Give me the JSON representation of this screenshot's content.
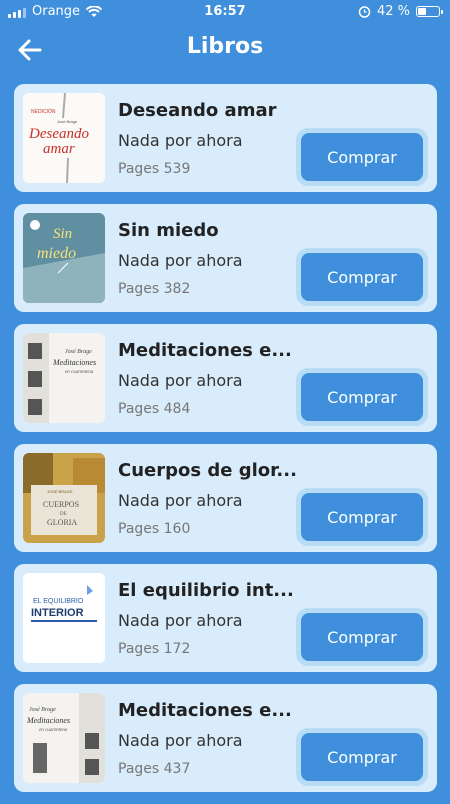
{
  "status_bar": {
    "carrier": "Orange",
    "time": "16:57",
    "battery": "42 %",
    "battery_level": 0.42
  },
  "header": {
    "title": "Libros"
  },
  "books": [
    {
      "title": "Deseando amar",
      "status": "Nada por ahora",
      "pages": "Pages 539",
      "button": "Comprar",
      "cover": "deseando-amar-cover"
    },
    {
      "title": "Sin miedo",
      "status": "Nada por ahora",
      "pages": "Pages 382",
      "button": "Comprar",
      "cover": "sin-miedo-cover"
    },
    {
      "title": "Meditaciones e...",
      "status": "Nada por ahora",
      "pages": "Pages 484",
      "button": "Comprar",
      "cover": "meditaciones-cover"
    },
    {
      "title": "Cuerpos de glor...",
      "status": "Nada por ahora",
      "pages": "Pages 160",
      "button": "Comprar",
      "cover": "cuerpos-de-gloria-cover"
    },
    {
      "title": "El equilibrio int...",
      "status": "Nada por ahora",
      "pages": "Pages 172",
      "button": "Comprar",
      "cover": "equilibrio-interior-cover"
    },
    {
      "title": "Meditaciones e...",
      "status": "Nada por ahora",
      "pages": "Pages 437",
      "button": "Comprar",
      "cover": "meditaciones-cover-2"
    }
  ],
  "colors": {
    "background": "#3f8fdc",
    "card": "#d9ecfb",
    "button": "#3f8fdc"
  }
}
